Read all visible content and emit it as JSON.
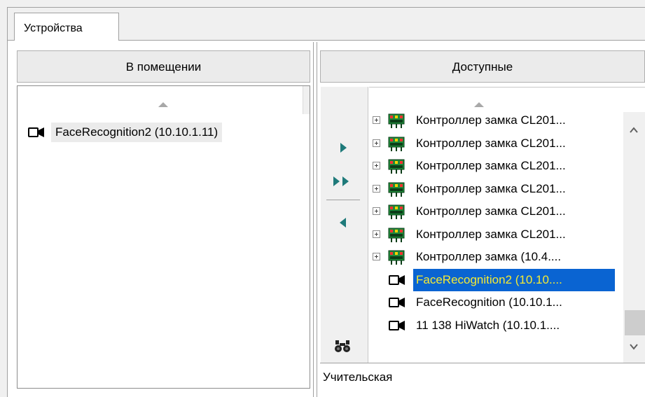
{
  "tab": {
    "label": "Устройства"
  },
  "left_panel": {
    "header": "В помещении",
    "items": [
      {
        "label": "FaceRecognition2 (10.10.1.11)",
        "icon": "camera-icon"
      }
    ]
  },
  "right_panel": {
    "header": "Доступные",
    "buttons": {
      "add": {
        "icon": "arrow-right-icon"
      },
      "add_all": {
        "icon": "double-arrow-right-icon"
      },
      "remove": {
        "icon": "arrow-left-icon"
      },
      "find": {
        "icon": "binoculars-icon"
      }
    },
    "items": [
      {
        "label": "Контроллер замка CL201...",
        "icon": "lock-controller-icon",
        "expandable": true
      },
      {
        "label": "Контроллер замка CL201...",
        "icon": "lock-controller-icon",
        "expandable": true
      },
      {
        "label": "Контроллер замка CL201...",
        "icon": "lock-controller-icon",
        "expandable": true
      },
      {
        "label": "Контроллер замка CL201...",
        "icon": "lock-controller-icon",
        "expandable": true
      },
      {
        "label": "Контроллер замка CL201...",
        "icon": "lock-controller-icon",
        "expandable": true
      },
      {
        "label": "Контроллер замка CL201...",
        "icon": "lock-controller-icon",
        "expandable": true
      },
      {
        "label": "Контроллер замка (10.4....",
        "icon": "lock-controller-icon",
        "expandable": true
      },
      {
        "label": "FaceRecognition2 (10.10....",
        "icon": "camera-icon",
        "expandable": false,
        "selected": true
      },
      {
        "label": "FaceRecognition (10.10.1...",
        "icon": "camera-icon",
        "expandable": false
      },
      {
        "label": "11 138 HiWatch (10.10.1....",
        "icon": "camera-icon",
        "expandable": false
      }
    ],
    "status_text": "Учительская"
  },
  "colors": {
    "selection_bg": "#0a64d2",
    "selection_text": "#f5ea33",
    "arrow_teal": "#1e7a7a"
  }
}
